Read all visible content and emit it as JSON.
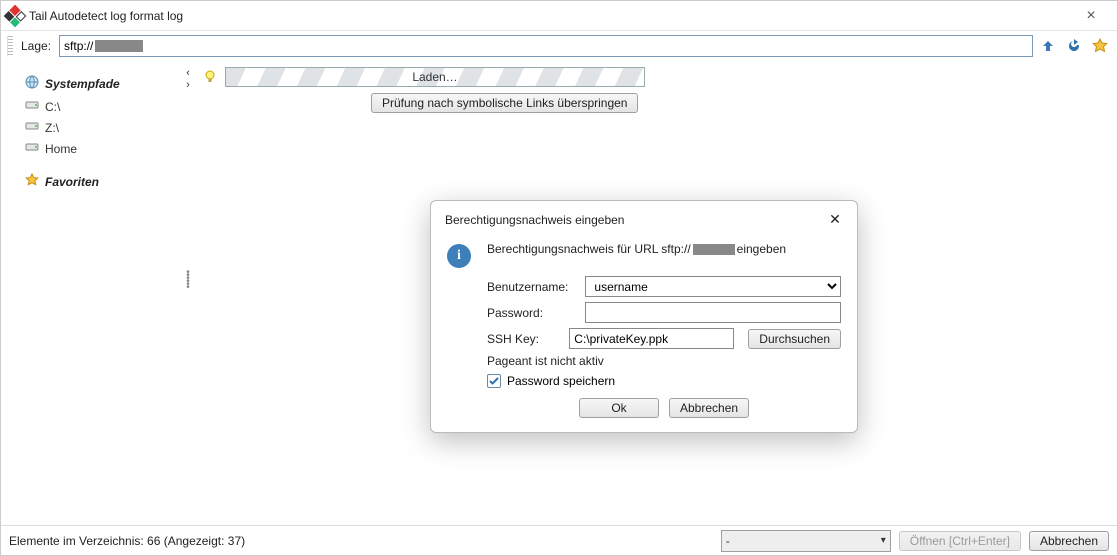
{
  "window": {
    "title": "Tail Autodetect log format log"
  },
  "address": {
    "label": "Lage:",
    "prefix": "sftp://"
  },
  "sidebar": {
    "systempaths_label": "Systempfade",
    "drives": [
      "C:\\",
      "Z:\\",
      "Home"
    ],
    "favorites_label": "Favoriten"
  },
  "loading": {
    "text": "Laden…",
    "skip_button": "Prüfung nach symbolische Links überspringen"
  },
  "dialog": {
    "title": "Berechtigungsnachweis eingeben",
    "message_prefix": "Berechtigungsnachweis für URL sftp://",
    "message_suffix": " eingeben",
    "username_label": "Benutzername:",
    "username_value": "username",
    "password_label": "Password:",
    "password_value": "",
    "sshkey_label": "SSH Key:",
    "sshkey_value": "C:\\privateKey.ppk",
    "browse_label": "Durchsuchen",
    "pageant_note": "Pageant ist nicht aktiv",
    "save_password_label": "Password speichern",
    "ok_label": "Ok",
    "cancel_label": "Abbrechen"
  },
  "status": {
    "text": "Elemente im Verzeichnis: 66 (Angezeigt: 37)",
    "filter_value": "-",
    "open_label": "Öffnen [Ctrl+Enter]",
    "cancel_label": "Abbrechen"
  }
}
